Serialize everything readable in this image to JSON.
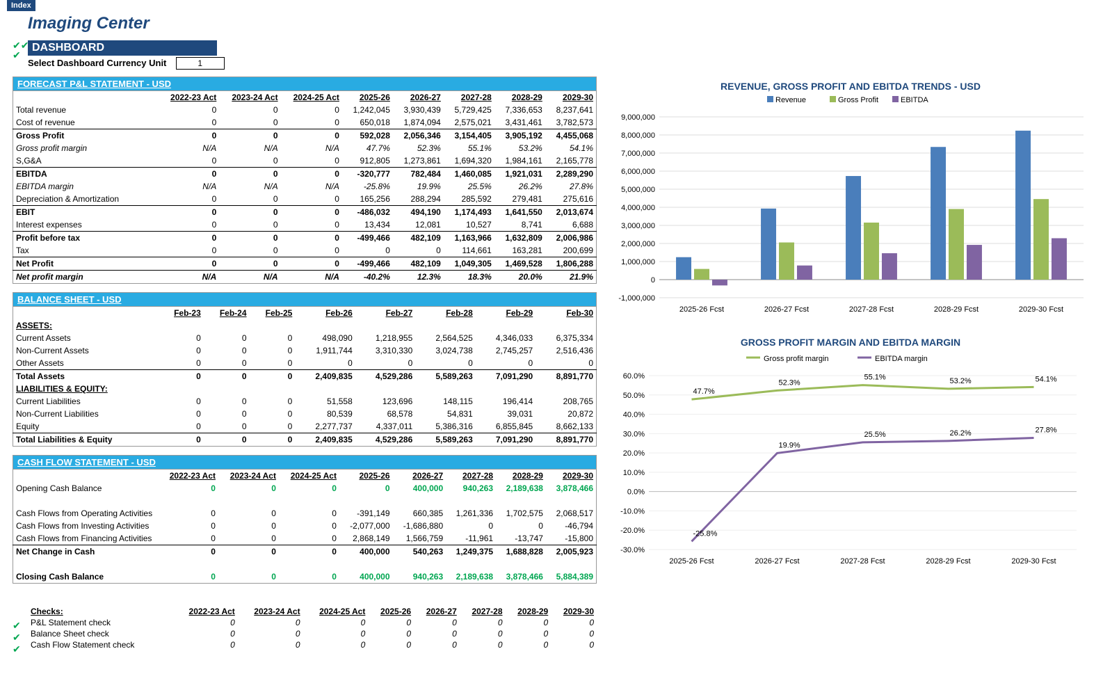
{
  "index_button": "Index",
  "title": "Imaging Center",
  "dashboard_header": "DASHBOARD",
  "currency_label": "Select Dashboard Currency Unit",
  "currency_value": "1",
  "pnl": {
    "header": "FORECAST P&L STATEMENT - USD",
    "cols": [
      "2022-23 Act",
      "2023-24 Act",
      "2024-25 Act",
      "2025-26",
      "2026-27",
      "2027-28",
      "2028-29",
      "2029-30"
    ],
    "rows": [
      {
        "label": "Total revenue",
        "vals": [
          "0",
          "0",
          "0",
          "1,242,045",
          "3,930,439",
          "5,729,425",
          "7,336,653",
          "8,237,641"
        ]
      },
      {
        "label": "Cost of revenue",
        "vals": [
          "0",
          "0",
          "0",
          "650,018",
          "1,874,094",
          "2,575,021",
          "3,431,461",
          "3,782,573"
        ]
      },
      {
        "label": "Gross Profit",
        "vals": [
          "0",
          "0",
          "0",
          "592,028",
          "2,056,346",
          "3,154,405",
          "3,905,192",
          "4,455,068"
        ],
        "bold": true,
        "topline": true
      },
      {
        "label": "Gross profit margin",
        "vals": [
          "N/A",
          "N/A",
          "N/A",
          "47.7%",
          "52.3%",
          "55.1%",
          "53.2%",
          "54.1%"
        ],
        "italic": true
      },
      {
        "label": "S,G&A",
        "vals": [
          "0",
          "0",
          "0",
          "912,805",
          "1,273,861",
          "1,694,320",
          "1,984,161",
          "2,165,778"
        ]
      },
      {
        "label": "EBITDA",
        "vals": [
          "0",
          "0",
          "0",
          "-320,777",
          "782,484",
          "1,460,085",
          "1,921,031",
          "2,289,290"
        ],
        "bold": true,
        "topline": true
      },
      {
        "label": "EBITDA margin",
        "vals": [
          "N/A",
          "N/A",
          "N/A",
          "-25.8%",
          "19.9%",
          "25.5%",
          "26.2%",
          "27.8%"
        ],
        "italic": true
      },
      {
        "label": "Depreciation & Amortization",
        "vals": [
          "0",
          "0",
          "0",
          "165,256",
          "288,294",
          "285,592",
          "279,481",
          "275,616"
        ]
      },
      {
        "label": "EBIT",
        "vals": [
          "0",
          "0",
          "0",
          "-486,032",
          "494,190",
          "1,174,493",
          "1,641,550",
          "2,013,674"
        ],
        "bold": true,
        "topline": true
      },
      {
        "label": "Interest expenses",
        "vals": [
          "0",
          "0",
          "0",
          "13,434",
          "12,081",
          "10,527",
          "8,741",
          "6,688"
        ]
      },
      {
        "label": "Profit before tax",
        "vals": [
          "0",
          "0",
          "0",
          "-499,466",
          "482,109",
          "1,163,966",
          "1,632,809",
          "2,006,986"
        ],
        "bold": true,
        "topline": true
      },
      {
        "label": "Tax",
        "vals": [
          "0",
          "0",
          "0",
          "0",
          "0",
          "114,661",
          "163,281",
          "200,699"
        ]
      },
      {
        "label": "Net Profit",
        "vals": [
          "0",
          "0",
          "0",
          "-499,466",
          "482,109",
          "1,049,305",
          "1,469,528",
          "1,806,288"
        ],
        "bold": true,
        "topline": true
      },
      {
        "label": "Net profit margin",
        "vals": [
          "N/A",
          "N/A",
          "N/A",
          "-40.2%",
          "12.3%",
          "18.3%",
          "20.0%",
          "21.9%"
        ],
        "italic": true,
        "bold": true,
        "topline": true
      }
    ]
  },
  "bs": {
    "header": "BALANCE SHEET - USD",
    "cols": [
      "Feb-23",
      "Feb-24",
      "Feb-25",
      "Feb-26",
      "Feb-27",
      "Feb-28",
      "Feb-29",
      "Feb-30"
    ],
    "assets_label": "ASSETS:",
    "liab_label": "LIABILITIES & EQUITY:",
    "assets": [
      {
        "label": "Current Assets",
        "vals": [
          "0",
          "0",
          "0",
          "498,090",
          "1,218,955",
          "2,564,525",
          "4,346,033",
          "6,375,334"
        ]
      },
      {
        "label": "Non-Current Assets",
        "vals": [
          "0",
          "0",
          "0",
          "1,911,744",
          "3,310,330",
          "3,024,738",
          "2,745,257",
          "2,516,436"
        ]
      },
      {
        "label": "Other Assets",
        "vals": [
          "0",
          "0",
          "0",
          "0",
          "0",
          "0",
          "0",
          "0"
        ]
      },
      {
        "label": "Total Assets",
        "vals": [
          "0",
          "0",
          "0",
          "2,409,835",
          "4,529,286",
          "5,589,263",
          "7,091,290",
          "8,891,770"
        ],
        "bold": true,
        "topline": true
      }
    ],
    "liab": [
      {
        "label": "Current Liabilities",
        "vals": [
          "0",
          "0",
          "0",
          "51,558",
          "123,696",
          "148,115",
          "196,414",
          "208,765"
        ]
      },
      {
        "label": "Non-Current Liabilities",
        "vals": [
          "0",
          "0",
          "0",
          "80,539",
          "68,578",
          "54,831",
          "39,031",
          "20,872"
        ]
      },
      {
        "label": "Equity",
        "vals": [
          "0",
          "0",
          "0",
          "2,277,737",
          "4,337,011",
          "5,386,316",
          "6,855,845",
          "8,662,133"
        ]
      },
      {
        "label": "Total Liabilities & Equity",
        "vals": [
          "0",
          "0",
          "0",
          "2,409,835",
          "4,529,286",
          "5,589,263",
          "7,091,290",
          "8,891,770"
        ],
        "bold": true,
        "topline": true
      }
    ]
  },
  "cf": {
    "header": "CASH FLOW STATEMENT -  USD",
    "cols": [
      "2022-23 Act",
      "2023-24 Act",
      "2024-25 Act",
      "2025-26",
      "2026-27",
      "2027-28",
      "2028-29",
      "2029-30"
    ],
    "rows": [
      {
        "label": "Opening Cash Balance",
        "vals": [
          "0",
          "0",
          "0",
          "0",
          "400,000",
          "940,263",
          "2,189,638",
          "3,878,466"
        ],
        "green": true
      },
      {
        "label": "",
        "vals": [
          "",
          "",
          "",
          "",
          "",
          "",
          "",
          ""
        ]
      },
      {
        "label": "Cash Flows from Operating Activities",
        "vals": [
          "0",
          "0",
          "0",
          "-391,149",
          "660,385",
          "1,261,336",
          "1,702,575",
          "2,068,517"
        ]
      },
      {
        "label": "Cash Flows from Investing Activities",
        "vals": [
          "0",
          "0",
          "0",
          "-2,077,000",
          "-1,686,880",
          "0",
          "0",
          "-46,794"
        ]
      },
      {
        "label": "Cash Flows from Financing Activities",
        "vals": [
          "0",
          "0",
          "0",
          "2,868,149",
          "1,566,759",
          "-11,961",
          "-13,747",
          "-15,800"
        ]
      },
      {
        "label": "Net Change in Cash",
        "vals": [
          "0",
          "0",
          "0",
          "400,000",
          "540,263",
          "1,249,375",
          "1,688,828",
          "2,005,923"
        ],
        "bold": true,
        "topline": true
      },
      {
        "label": "",
        "vals": [
          "",
          "",
          "",
          "",
          "",
          "",
          "",
          ""
        ]
      },
      {
        "label": "Closing Cash Balance",
        "vals": [
          "0",
          "0",
          "0",
          "400,000",
          "940,263",
          "2,189,638",
          "3,878,466",
          "5,884,389"
        ],
        "bold": true,
        "green": true
      }
    ]
  },
  "checks": {
    "header": "Checks:",
    "cols": [
      "2022-23 Act",
      "2023-24 Act",
      "2024-25 Act",
      "2025-26",
      "2026-27",
      "2027-28",
      "2028-29",
      "2029-30"
    ],
    "rows": [
      {
        "label": "P&L Statement check",
        "vals": [
          "0",
          "0",
          "0",
          "0",
          "0",
          "0",
          "0",
          "0"
        ]
      },
      {
        "label": "Balance Sheet check",
        "vals": [
          "0",
          "0",
          "0",
          "0",
          "0",
          "0",
          "0",
          "0"
        ]
      },
      {
        "label": "Cash Flow Statement check",
        "vals": [
          "0",
          "0",
          "0",
          "0",
          "0",
          "0",
          "0",
          "0"
        ]
      }
    ]
  },
  "chart1": {
    "title": "REVENUE, GROSS PROFIT AND EBITDA TRENDS - USD",
    "legend": [
      "Revenue",
      "Gross Profit",
      "EBITDA"
    ]
  },
  "chart2": {
    "title": "GROSS PROFIT MARGIN AND EBITDA MARGIN",
    "legend": [
      "Gross profit margin",
      "EBITDA margin"
    ]
  },
  "chart_data": [
    {
      "type": "bar",
      "title": "REVENUE, GROSS PROFIT AND EBITDA TRENDS - USD",
      "categories": [
        "2025-26 Fcst",
        "2026-27 Fcst",
        "2027-28 Fcst",
        "2028-29 Fcst",
        "2029-30 Fcst"
      ],
      "series": [
        {
          "name": "Revenue",
          "values": [
            1242045,
            3930439,
            5729425,
            7336653,
            8237641
          ],
          "color": "#4a7ebb"
        },
        {
          "name": "Gross Profit",
          "values": [
            592028,
            2056346,
            3154405,
            3905192,
            4455068
          ],
          "color": "#9bbb59"
        },
        {
          "name": "EBITDA",
          "values": [
            -320777,
            782484,
            1460085,
            1921031,
            2289290
          ],
          "color": "#8064a2"
        }
      ],
      "ylim": [
        -1000000,
        9000000
      ],
      "ytick": 1000000,
      "ylabel": "",
      "xlabel": ""
    },
    {
      "type": "line",
      "title": "GROSS PROFIT MARGIN AND EBITDA MARGIN",
      "categories": [
        "2025-26 Fcst",
        "2026-27 Fcst",
        "2027-28 Fcst",
        "2028-29 Fcst",
        "2029-30 Fcst"
      ],
      "series": [
        {
          "name": "Gross profit margin",
          "values": [
            47.7,
            52.3,
            55.1,
            53.2,
            54.1
          ],
          "labels": [
            "47.7%",
            "52.3%",
            "55.1%",
            "53.2%",
            "54.1%"
          ],
          "color": "#9bbb59"
        },
        {
          "name": "EBITDA margin",
          "values": [
            -25.8,
            19.9,
            25.5,
            26.2,
            27.8
          ],
          "labels": [
            "-25.8%",
            "19.9%",
            "25.5%",
            "26.2%",
            "27.8%"
          ],
          "color": "#8064a2"
        }
      ],
      "ylim": [
        -30,
        60
      ],
      "ytick": 10,
      "ylabel": "",
      "xlabel": ""
    }
  ]
}
